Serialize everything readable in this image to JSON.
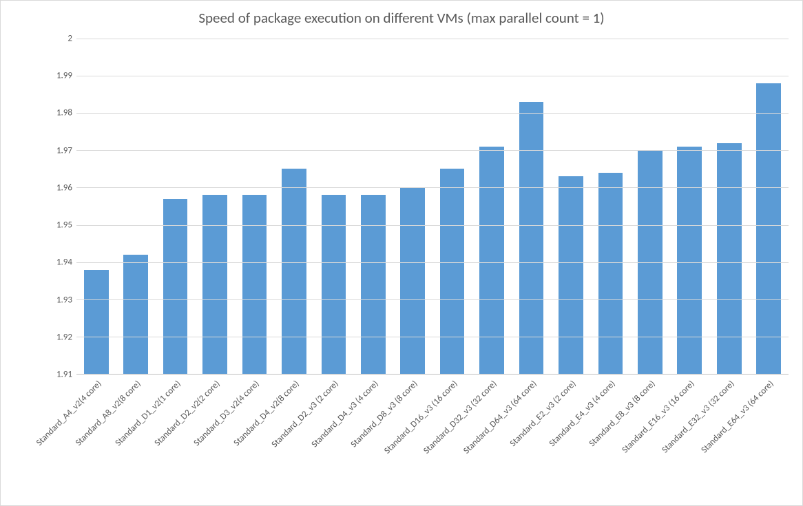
{
  "chart_data": {
    "type": "bar",
    "title": "Speed of package execution on different VMs (max parallel count = 1)",
    "xlabel": "",
    "ylabel": "",
    "ylim": [
      1.91,
      2
    ],
    "yticks": [
      1.91,
      1.92,
      1.93,
      1.94,
      1.95,
      1.96,
      1.97,
      1.98,
      1.99,
      2
    ],
    "categories": [
      "Standard_A4_v2(4 core)",
      "Standard_A8_v2(8 core)",
      "Standard_D1_v2(1 core)",
      "Standard_D2_v2(2 core)",
      "Standard_D3_v2(4 core)",
      "Standard_D4_v2(8 core)",
      "Standard_D2_v3 (2 core)",
      "Standard_D4_v3 (4 core)",
      "Standard_D8_v3 (8 core)",
      "Standard_D16_v3 (16 core)",
      "Standard_D32_v3 (32 core)",
      "Standard_D64_v3 (64 core)",
      "Standard_E2_v3 (2 core)",
      "Standard_E4_v3 (4 core)",
      "Standard_E8_v3 (8 core)",
      "Standard_E16_v3 (16 core)",
      "Standard_E32_v3 (32 core)",
      "Standard_E64_v3 (64 core)"
    ],
    "values": [
      1.938,
      1.942,
      1.957,
      1.958,
      1.958,
      1.965,
      1.958,
      1.958,
      1.96,
      1.965,
      1.971,
      1.983,
      1.963,
      1.964,
      1.97,
      1.971,
      1.972,
      1.988
    ],
    "series_color": "#5b9bd5",
    "grid": true,
    "legend": false
  }
}
